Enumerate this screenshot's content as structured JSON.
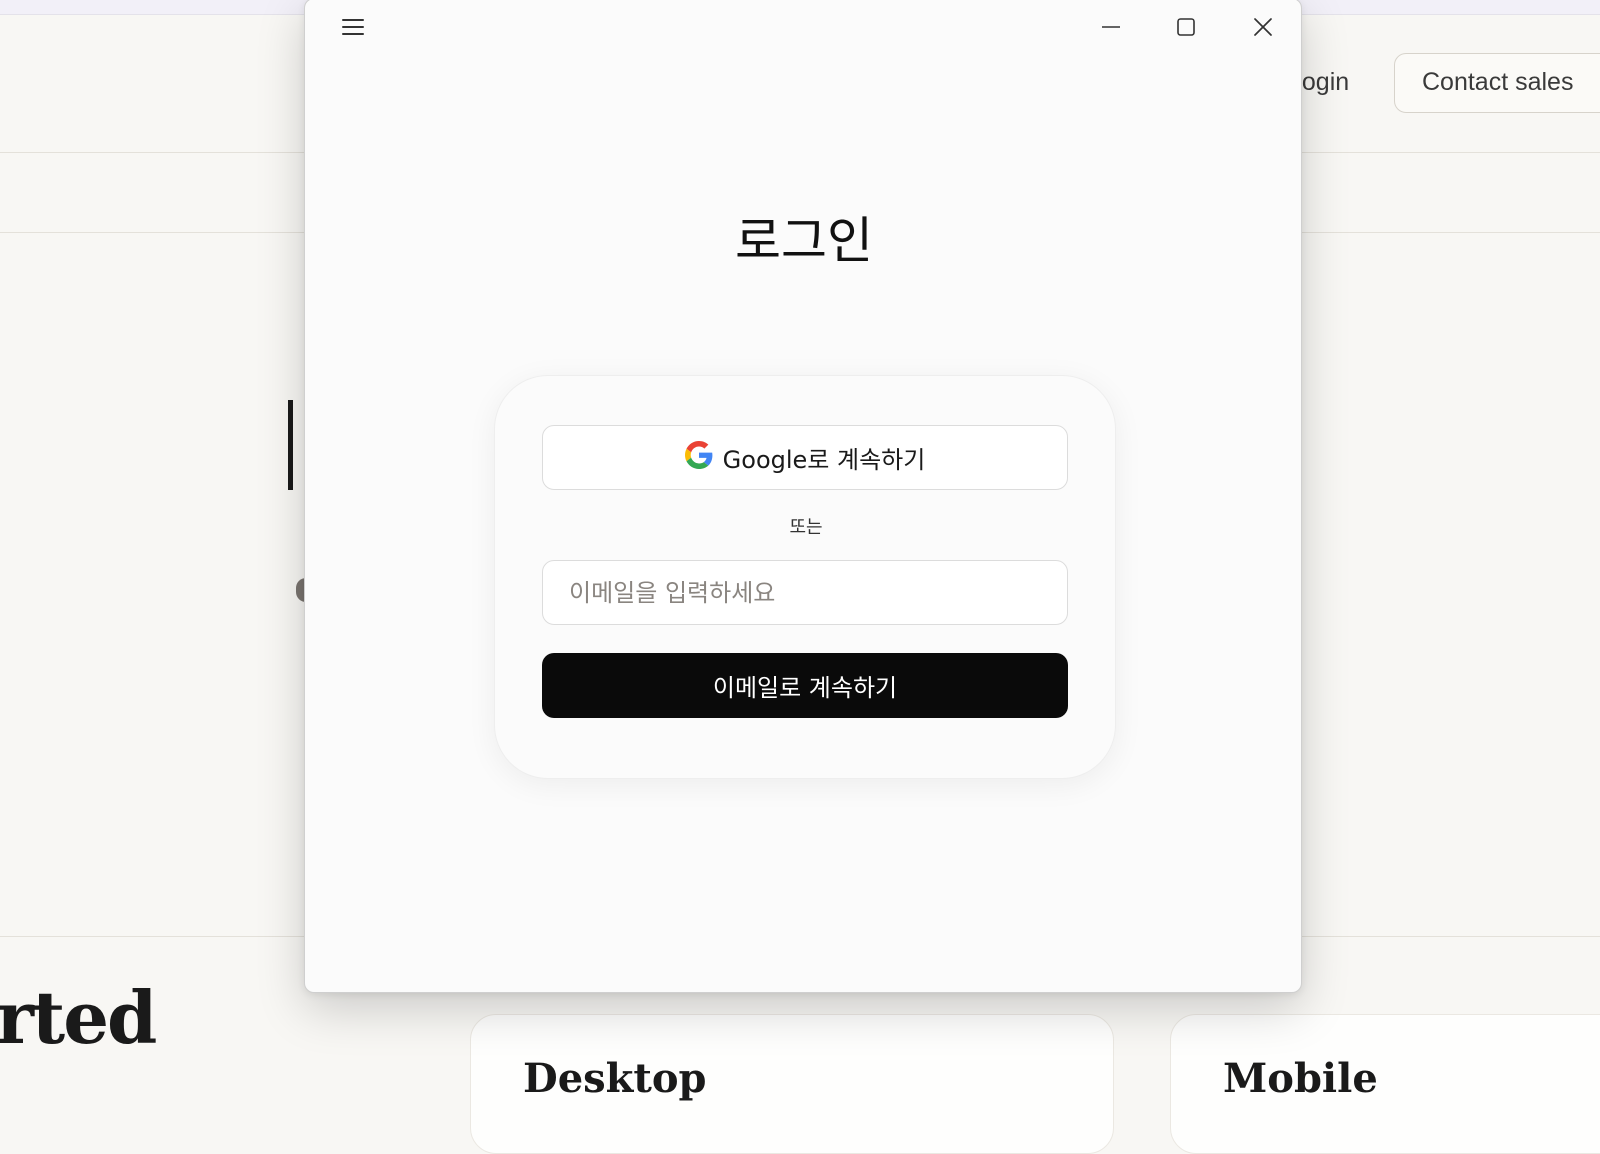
{
  "background_page": {
    "nav": {
      "login_label": "Login",
      "contact_sales_label": "Contact sales"
    },
    "section_heading_fragment": "rted",
    "cards": [
      {
        "title": "Desktop"
      },
      {
        "title": "Mobile"
      }
    ]
  },
  "dialog": {
    "titlebar": {
      "menu_icon": "hamburger-menu-icon",
      "minimize_icon": "minimize-icon",
      "maximize_icon": "maximize-icon",
      "close_icon": "close-icon"
    },
    "title": "로그인",
    "google_button": {
      "icon": "google-logo-icon",
      "label": "Google로 계속하기"
    },
    "divider_text": "또는",
    "email_input": {
      "placeholder": "이메일을 입력하세요",
      "value": ""
    },
    "email_button_label": "이메일로 계속하기"
  },
  "colors": {
    "page_background": "#f8f7f4",
    "dialog_background": "#fbfbfb",
    "primary_button": "#0a0a0a",
    "primary_button_text": "#ffffff"
  }
}
